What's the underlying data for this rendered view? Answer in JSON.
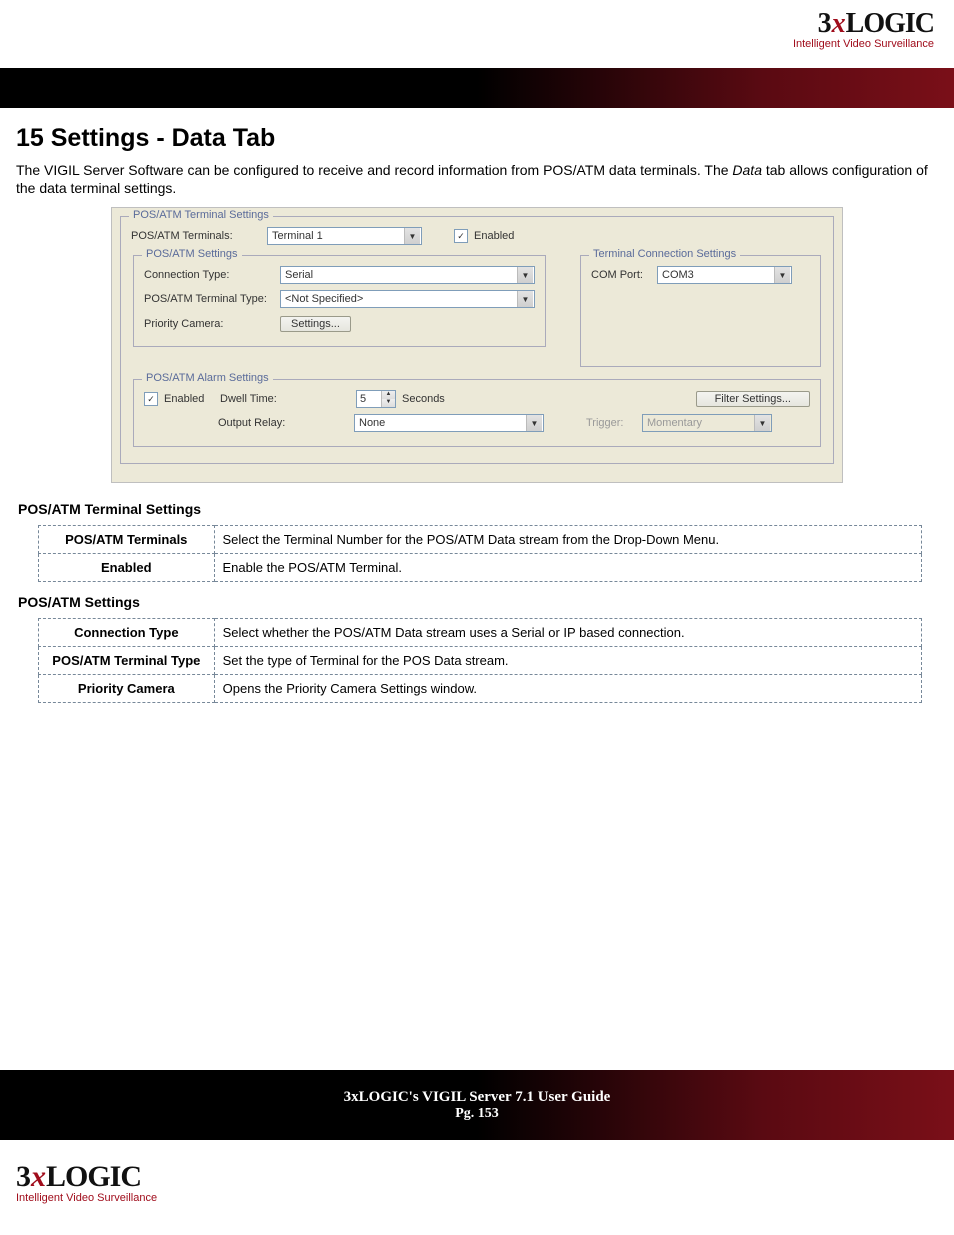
{
  "brand": {
    "name_prefix": "3",
    "name_x": "x",
    "name_suffix": "LOGIC",
    "tagline": "Intelligent Video Surveillance"
  },
  "heading": "15 Settings - Data Tab",
  "intro_part1": "The VIGIL Server Software can be configured to receive and record information from POS/ATM data terminals. The ",
  "intro_italic": "Data",
  "intro_part2": " tab allows configuration of the data terminal settings.",
  "screenshot": {
    "group_terminal_settings": "POS/ATM Terminal Settings",
    "terminals_label": "POS/ATM Terminals:",
    "terminals_value": "Terminal 1",
    "enabled_label": "Enabled",
    "group_settings": "POS/ATM Settings",
    "connection_type_label": "Connection Type:",
    "connection_type_value": "Serial",
    "terminal_type_label": "POS/ATM Terminal Type:",
    "terminal_type_value": "<Not Specified>",
    "priority_camera_label": "Priority Camera:",
    "settings_button": "Settings...",
    "group_conn": "Terminal Connection Settings",
    "com_port_label": "COM Port:",
    "com_port_value": "COM3",
    "group_alarm": "POS/ATM Alarm Settings",
    "alarm_enabled_label": "Enabled",
    "dwell_time_label": "Dwell Time:",
    "dwell_time_value": "5",
    "seconds_label": "Seconds",
    "output_relay_label": "Output Relay:",
    "output_relay_value": "None",
    "filter_settings_button": "Filter Settings...",
    "trigger_label": "Trigger:",
    "trigger_value": "Momentary"
  },
  "section1_title": "POS/ATM Terminal Settings",
  "table1": [
    {
      "key": "POS/ATM Terminals",
      "val": "Select the Terminal Number for the POS/ATM Data stream from the Drop-Down Menu."
    },
    {
      "key": "Enabled",
      "val": "Enable the POS/ATM Terminal."
    }
  ],
  "section2_title": "POS/ATM Settings",
  "table2": [
    {
      "key": "Connection Type",
      "val": "Select whether the POS/ATM Data stream uses a Serial or IP based connection."
    },
    {
      "key": "POS/ATM Terminal Type",
      "val": "Set the type of Terminal for the POS Data stream."
    },
    {
      "key": "Priority Camera",
      "val": "Opens the Priority Camera Settings window."
    }
  ],
  "footer": {
    "title": "3xLOGIC's VIGIL Server 7.1 User Guide",
    "page": "Pg. 153"
  }
}
